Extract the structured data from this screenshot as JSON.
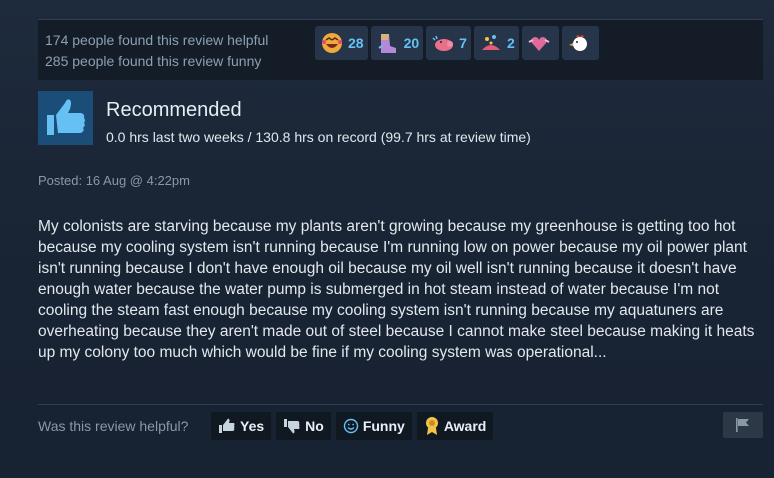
{
  "helpful": {
    "helpful_line": "174 people found this review helpful",
    "funny_line": "285 people found this review funny"
  },
  "awards": [
    {
      "icon": "laughing-face-icon",
      "count": "28"
    },
    {
      "icon": "boot-kick-icon",
      "count": "20"
    },
    {
      "icon": "pig-icon",
      "count": "7"
    },
    {
      "icon": "party-sparkle-icon",
      "count": "2"
    },
    {
      "icon": "heart-wings-icon",
      "count": ""
    },
    {
      "icon": "rooster-icon",
      "count": ""
    }
  ],
  "review": {
    "verdict": "Recommended",
    "hours": "0.0 hrs last two weeks / 130.8 hrs on record (99.7 hrs at review time)",
    "posted": "Posted: 16 Aug @ 4:22pm",
    "text": "My colonists are starving because my plants aren't growing because my greenhouse is getting too hot because my cooling system isn't running because I'm running low on power because my oil power plant isn't running because I don't have enough oil because my oil well isn't running because it doesn't have enough water because the water pump is submerged in hot steam instead of water because I'm not cooling the steam fast enough because my cooling system isn't running because my aquatuners are overheating because they aren't made out of steel because I cannot make steel because making it heats up my colony too much which would be fine if my cooling system was operational..."
  },
  "footer": {
    "question": "Was this review helpful?",
    "yes_label": "Yes",
    "no_label": "No",
    "funny_label": "Funny",
    "award_label": "Award"
  },
  "colors": {
    "accent_blue": "#66c0f4",
    "thumb_bg": "#1a4d78"
  }
}
